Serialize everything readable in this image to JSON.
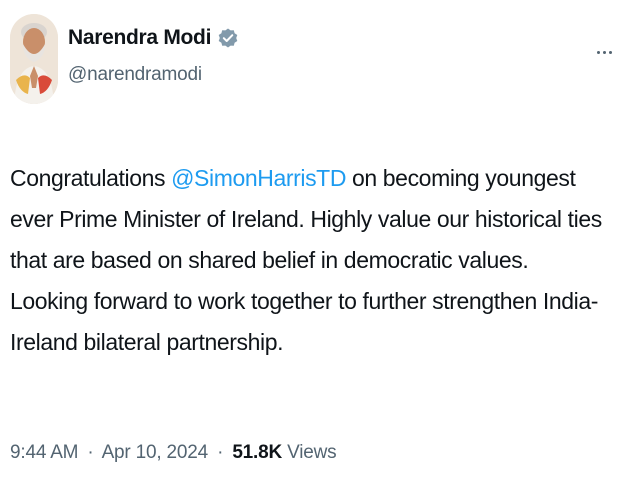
{
  "author": {
    "name": "Narendra Modi",
    "handle": "@narendramodi",
    "verified": true,
    "verified_color": "#829aab"
  },
  "tweet": {
    "text_before": "Congratulations ",
    "mention": "@SimonHarrisTD",
    "text_after": " on becoming youngest ever Prime Minister of Ireland. Highly value our historical ties that are based on shared belief in democratic values. Looking forward to work together to further strengthen India- Ireland bilateral partnership."
  },
  "meta": {
    "time": "9:44 AM",
    "separator": "·",
    "date": "Apr 10, 2024",
    "views_count": "51.8K",
    "views_label": "Views"
  },
  "icons": {
    "more": "more-horizontal-icon",
    "verified": "verified-badge-icon"
  },
  "colors": {
    "link": "#1d9bf0",
    "secondary_text": "#536471",
    "primary_text": "#0f1419"
  }
}
